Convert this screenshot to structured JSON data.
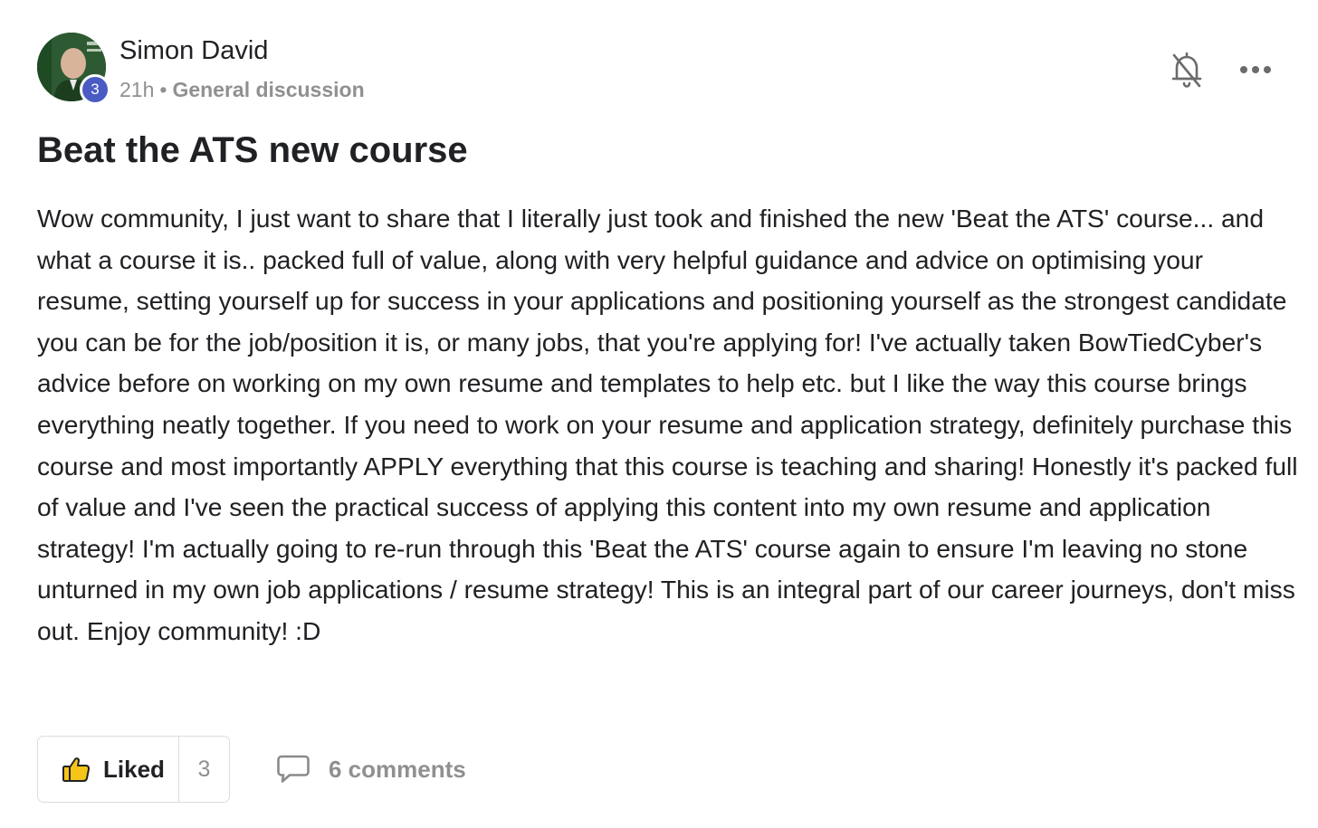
{
  "post": {
    "author": {
      "name": "Simon David",
      "level_badge": "3"
    },
    "time": "21h",
    "separator": "•",
    "category": "General discussion",
    "title": "Beat the ATS new course",
    "body": "Wow community, I just want to share that I literally just took and finished the new 'Beat the ATS' course... and what a course it is.. packed full of value, along with very helpful guidance and advice on optimising your resume, setting yourself up for success in your applications and positioning yourself as the strongest candidate you can be for the job/position it is, or many jobs, that you're applying for! I've actually taken BowTiedCyber's advice before on working on my own resume and templates to help etc. but I like the way this course brings everything neatly together. If you need to work on your resume and application strategy, definitely purchase this course and most importantly APPLY everything that this course is teaching and sharing! Honestly it's packed full of value and I've seen the practical success of applying this content into my own resume and application strategy! I'm actually going to re-run through this 'Beat the ATS' course again to ensure I'm leaving no stone unturned in my own job applications / resume strategy! This is an integral part of our career journeys, don't miss out. Enjoy community! :D"
  },
  "actions": {
    "like_label": "Liked",
    "like_count": "3",
    "comments_label": "6 comments"
  },
  "icons": {
    "notifications": "bell-off-icon",
    "more": "more-horizontal-icon",
    "like": "thumbs-up-icon",
    "comments": "comment-icon"
  },
  "colors": {
    "badge": "#4a5bc4",
    "like_icon": "#f5c518",
    "muted_text": "#909090"
  }
}
